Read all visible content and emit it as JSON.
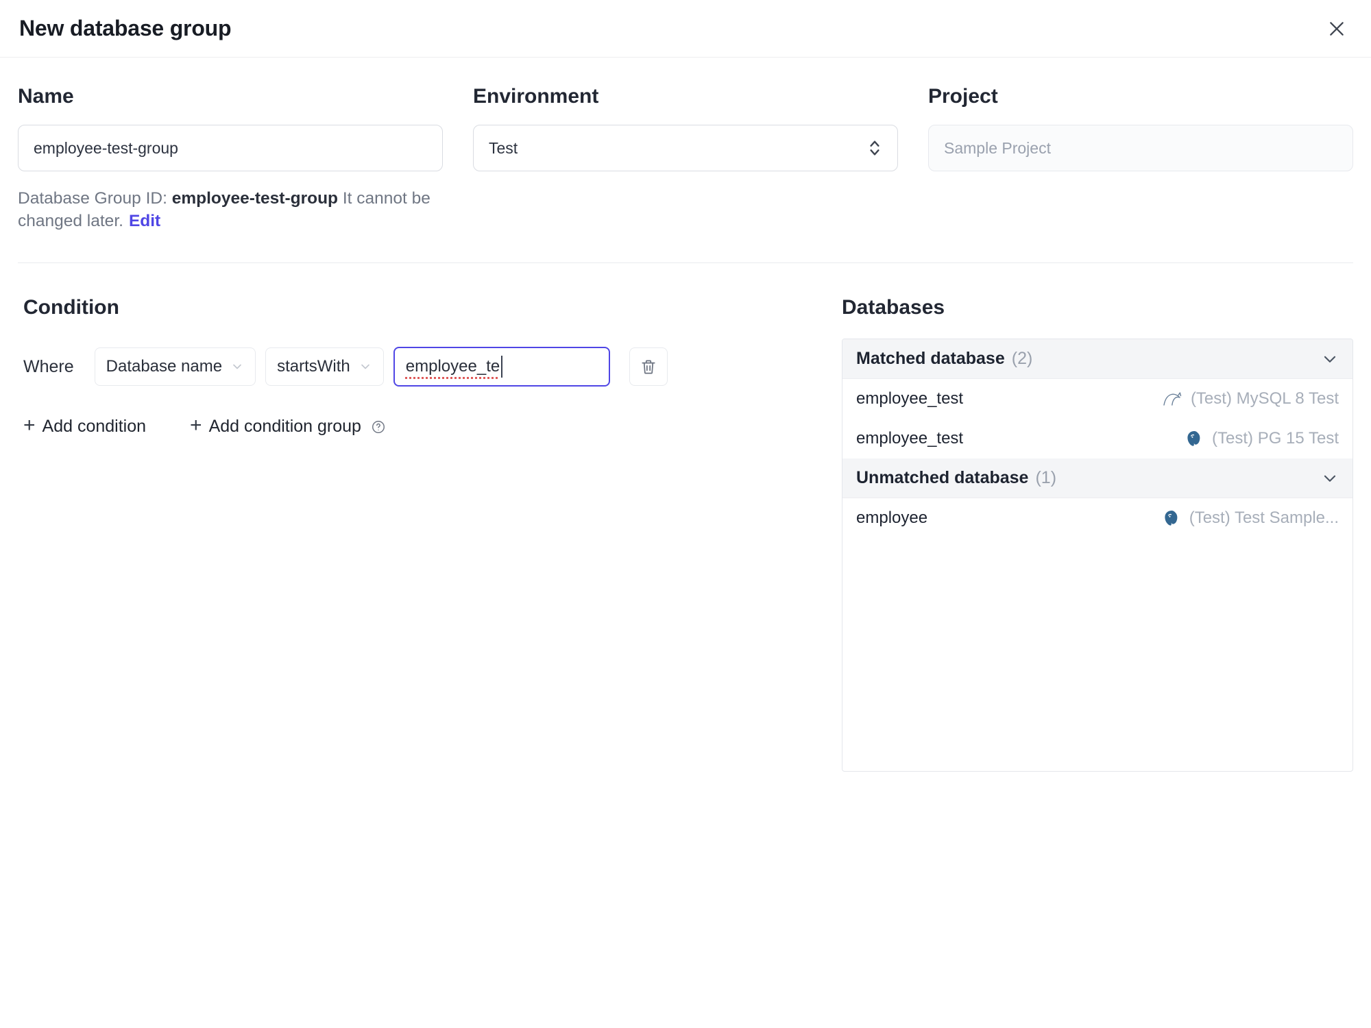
{
  "dialog": {
    "title": "New database group"
  },
  "form": {
    "name": {
      "label": "Name",
      "value": "employee-test-group"
    },
    "environment": {
      "label": "Environment",
      "value": "Test"
    },
    "project": {
      "label": "Project",
      "value": "Sample Project"
    },
    "group_id": {
      "prefix": "Database Group ID: ",
      "id": "employee-test-group",
      "suffix": " It cannot be changed later.",
      "edit_label": "Edit"
    }
  },
  "condition": {
    "heading": "Condition",
    "where_label": "Where",
    "field_selector": "Database name",
    "operator_selector": "startsWith",
    "value_input": "employee_te",
    "add_condition_label": "Add condition",
    "add_condition_group_label": "Add condition group"
  },
  "databases": {
    "heading": "Databases",
    "groups": [
      {
        "label": "Matched database",
        "count": "(2)",
        "rows": [
          {
            "name": "employee_test",
            "engine": "mysql",
            "env": "(Test) MySQL 8 Test"
          },
          {
            "name": "employee_test",
            "engine": "postgres",
            "env": "(Test) PG 15 Test"
          }
        ]
      },
      {
        "label": "Unmatched database",
        "count": "(1)",
        "rows": [
          {
            "name": "employee",
            "engine": "postgres",
            "env": "(Test) Test Sample..."
          }
        ]
      }
    ]
  },
  "colors": {
    "accent": "#4f46e5",
    "border": "#e5e7eb",
    "muted": "#9ca3af"
  }
}
